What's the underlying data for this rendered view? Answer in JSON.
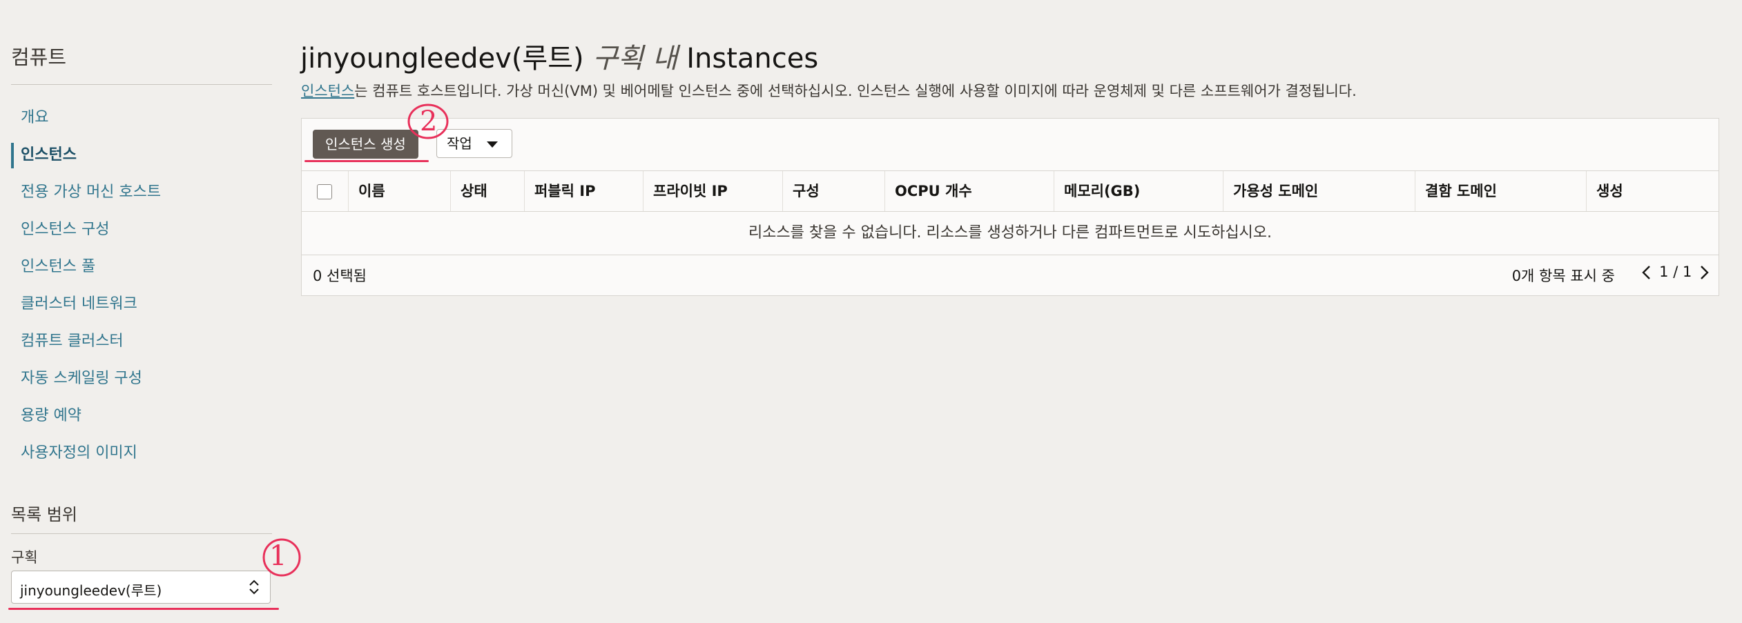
{
  "sidebar": {
    "title": "컴퓨트",
    "items": [
      {
        "label": "개요",
        "active": false
      },
      {
        "label": "인스턴스",
        "active": true
      },
      {
        "label": "전용 가상 머신 호스트",
        "active": false
      },
      {
        "label": "인스턴스 구성",
        "active": false
      },
      {
        "label": "인스턴스 풀",
        "active": false
      },
      {
        "label": "클러스터 네트워크",
        "active": false
      },
      {
        "label": "컴퓨트 클러스터",
        "active": false
      },
      {
        "label": "자동 스케일링 구성",
        "active": false
      },
      {
        "label": "용량 예약",
        "active": false
      },
      {
        "label": "사용자정의 이미지",
        "active": false
      }
    ],
    "scope_title": "목록 범위",
    "compartment_label": "구획",
    "compartment_value": "jinyoungleedev(루트)"
  },
  "header": {
    "title_prefix": "jinyoungleedev(루트)",
    "title_in": "구획 내",
    "title_suffix": "Instances",
    "desc_link": "인스턴스",
    "desc_text": "는 컴퓨트 호스트입니다. 가상 머신(VM) 및 베어메탈 인스턴스 중에 선택하십시오. 인스턴스 실행에 사용할 이미지에 따라 운영체제 및 다른 소프트웨어가 결정됩니다."
  },
  "toolbar": {
    "create_label": "인스턴스 생성",
    "actions_label": "작업"
  },
  "table": {
    "columns": [
      "이름",
      "상태",
      "퍼블릭 IP",
      "프라이빗 IP",
      "구성",
      "OCPU 개수",
      "메모리(GB)",
      "가용성 도메인",
      "결함 도메인",
      "생성"
    ],
    "empty_message": "리소스를 찾을 수 없습니다. 리소스를 생성하거나 다른 컴파트먼트로 시도하십시오.",
    "selected_text": "0 선택됨",
    "items_text": "0개 항목 표시 중",
    "page_text": "1 / 1"
  },
  "annotations": {
    "marker_1": "1",
    "marker_2": "2",
    "color": "#e8305a"
  }
}
